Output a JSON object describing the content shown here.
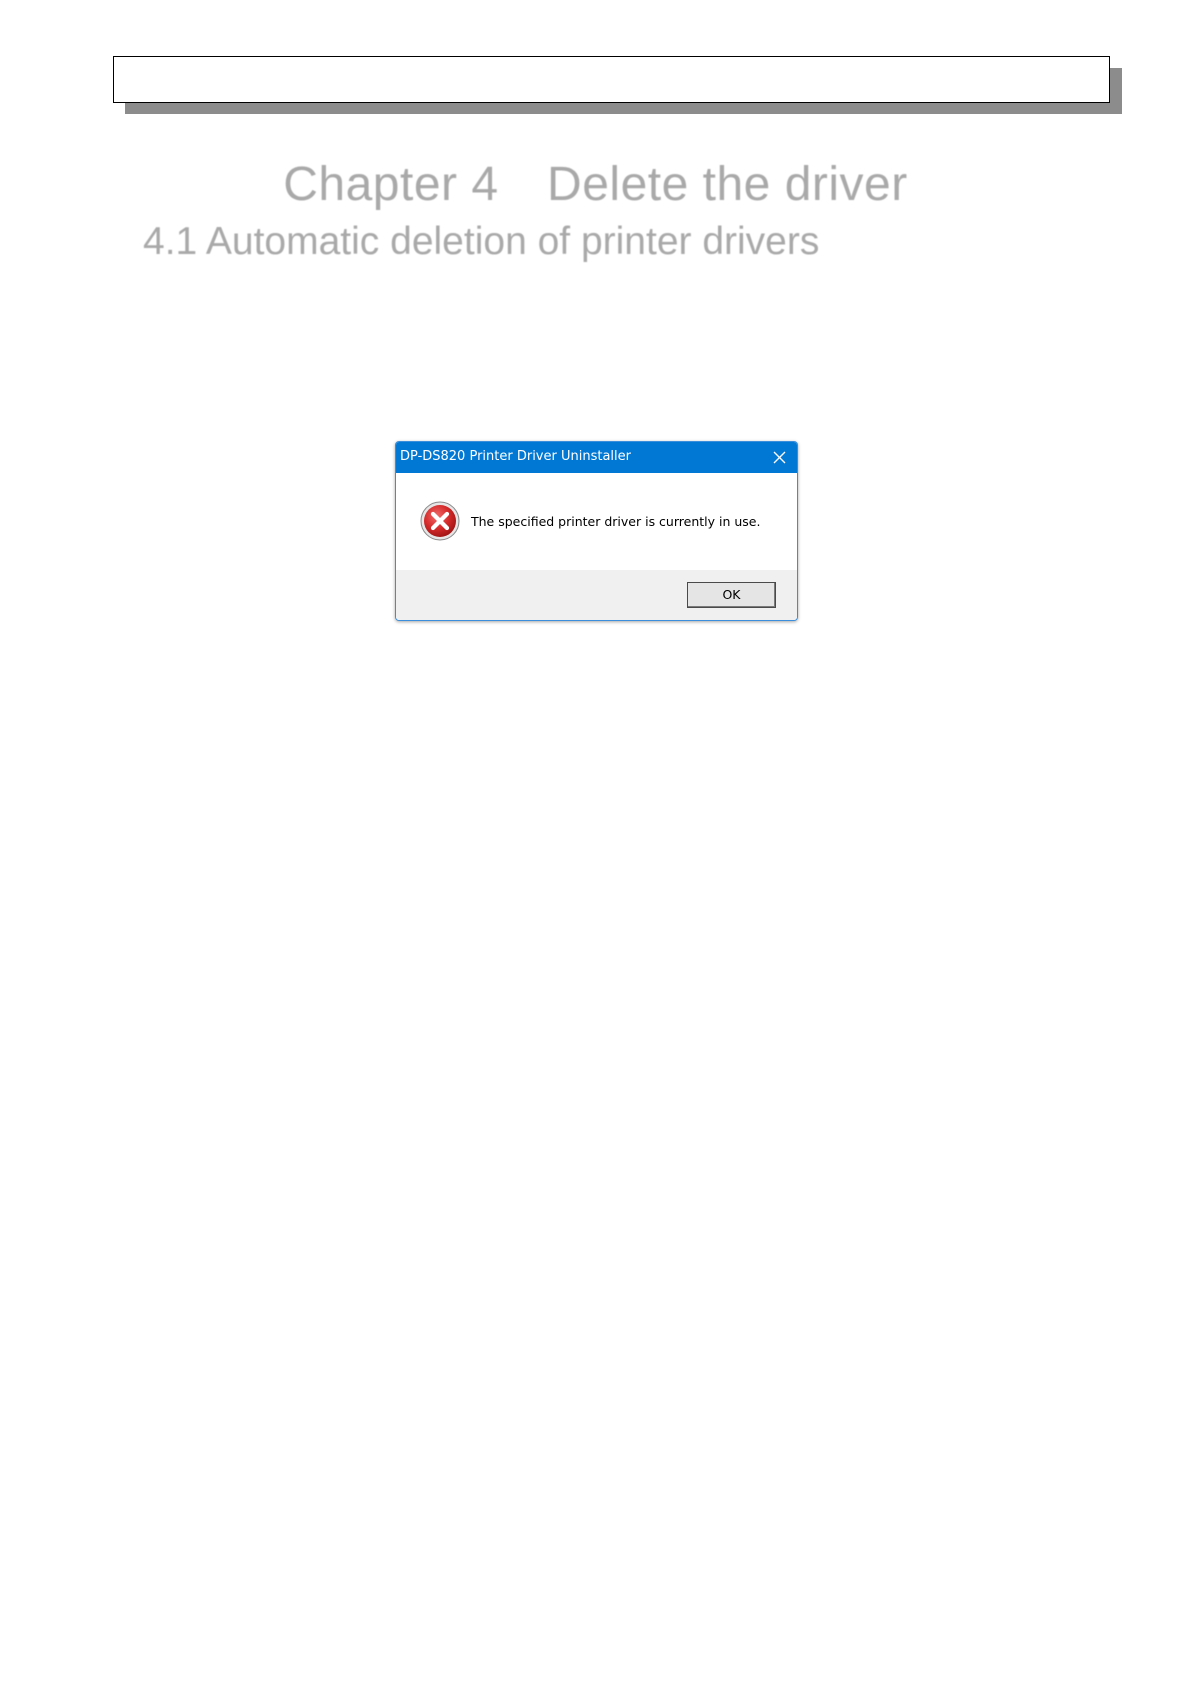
{
  "document": {
    "chapter_title": "Chapter 4　Delete the driver",
    "section_title": "4.1 Automatic deletion of printer drivers"
  },
  "dialog": {
    "title": "DP-DS820 Printer Driver Uninstaller",
    "message": "The specified printer driver is currently in use.",
    "ok_label": "OK",
    "icon": "error-icon",
    "close_icon": "close-icon",
    "colors": {
      "titlebar": "#0078d4",
      "error_red": "#d42a2a",
      "footer": "#f0f0f0"
    }
  }
}
